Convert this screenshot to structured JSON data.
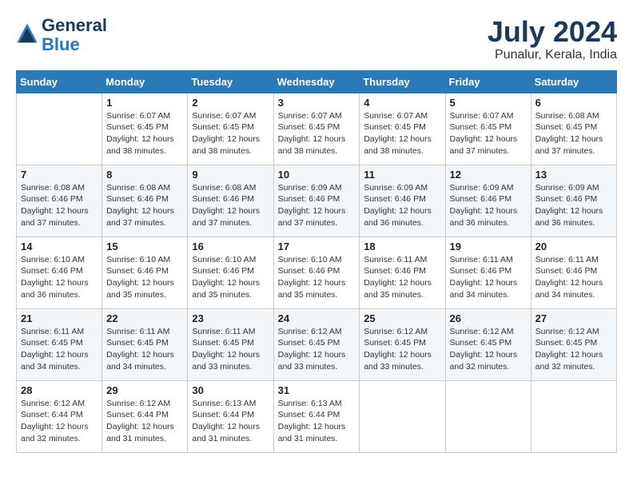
{
  "header": {
    "logo_line1": "General",
    "logo_line2": "Blue",
    "month_year": "July 2024",
    "location": "Punalur, Kerala, India"
  },
  "calendar": {
    "days_of_week": [
      "Sunday",
      "Monday",
      "Tuesday",
      "Wednesday",
      "Thursday",
      "Friday",
      "Saturday"
    ],
    "weeks": [
      [
        {
          "day": "",
          "info": ""
        },
        {
          "day": "1",
          "info": "Sunrise: 6:07 AM\nSunset: 6:45 PM\nDaylight: 12 hours\nand 38 minutes."
        },
        {
          "day": "2",
          "info": "Sunrise: 6:07 AM\nSunset: 6:45 PM\nDaylight: 12 hours\nand 38 minutes."
        },
        {
          "day": "3",
          "info": "Sunrise: 6:07 AM\nSunset: 6:45 PM\nDaylight: 12 hours\nand 38 minutes."
        },
        {
          "day": "4",
          "info": "Sunrise: 6:07 AM\nSunset: 6:45 PM\nDaylight: 12 hours\nand 38 minutes."
        },
        {
          "day": "5",
          "info": "Sunrise: 6:07 AM\nSunset: 6:45 PM\nDaylight: 12 hours\nand 37 minutes."
        },
        {
          "day": "6",
          "info": "Sunrise: 6:08 AM\nSunset: 6:45 PM\nDaylight: 12 hours\nand 37 minutes."
        }
      ],
      [
        {
          "day": "7",
          "info": "Sunrise: 6:08 AM\nSunset: 6:46 PM\nDaylight: 12 hours\nand 37 minutes."
        },
        {
          "day": "8",
          "info": "Sunrise: 6:08 AM\nSunset: 6:46 PM\nDaylight: 12 hours\nand 37 minutes."
        },
        {
          "day": "9",
          "info": "Sunrise: 6:08 AM\nSunset: 6:46 PM\nDaylight: 12 hours\nand 37 minutes."
        },
        {
          "day": "10",
          "info": "Sunrise: 6:09 AM\nSunset: 6:46 PM\nDaylight: 12 hours\nand 37 minutes."
        },
        {
          "day": "11",
          "info": "Sunrise: 6:09 AM\nSunset: 6:46 PM\nDaylight: 12 hours\nand 36 minutes."
        },
        {
          "day": "12",
          "info": "Sunrise: 6:09 AM\nSunset: 6:46 PM\nDaylight: 12 hours\nand 36 minutes."
        },
        {
          "day": "13",
          "info": "Sunrise: 6:09 AM\nSunset: 6:46 PM\nDaylight: 12 hours\nand 36 minutes."
        }
      ],
      [
        {
          "day": "14",
          "info": "Sunrise: 6:10 AM\nSunset: 6:46 PM\nDaylight: 12 hours\nand 36 minutes."
        },
        {
          "day": "15",
          "info": "Sunrise: 6:10 AM\nSunset: 6:46 PM\nDaylight: 12 hours\nand 35 minutes."
        },
        {
          "day": "16",
          "info": "Sunrise: 6:10 AM\nSunset: 6:46 PM\nDaylight: 12 hours\nand 35 minutes."
        },
        {
          "day": "17",
          "info": "Sunrise: 6:10 AM\nSunset: 6:46 PM\nDaylight: 12 hours\nand 35 minutes."
        },
        {
          "day": "18",
          "info": "Sunrise: 6:11 AM\nSunset: 6:46 PM\nDaylight: 12 hours\nand 35 minutes."
        },
        {
          "day": "19",
          "info": "Sunrise: 6:11 AM\nSunset: 6:46 PM\nDaylight: 12 hours\nand 34 minutes."
        },
        {
          "day": "20",
          "info": "Sunrise: 6:11 AM\nSunset: 6:46 PM\nDaylight: 12 hours\nand 34 minutes."
        }
      ],
      [
        {
          "day": "21",
          "info": "Sunrise: 6:11 AM\nSunset: 6:45 PM\nDaylight: 12 hours\nand 34 minutes."
        },
        {
          "day": "22",
          "info": "Sunrise: 6:11 AM\nSunset: 6:45 PM\nDaylight: 12 hours\nand 34 minutes."
        },
        {
          "day": "23",
          "info": "Sunrise: 6:11 AM\nSunset: 6:45 PM\nDaylight: 12 hours\nand 33 minutes."
        },
        {
          "day": "24",
          "info": "Sunrise: 6:12 AM\nSunset: 6:45 PM\nDaylight: 12 hours\nand 33 minutes."
        },
        {
          "day": "25",
          "info": "Sunrise: 6:12 AM\nSunset: 6:45 PM\nDaylight: 12 hours\nand 33 minutes."
        },
        {
          "day": "26",
          "info": "Sunrise: 6:12 AM\nSunset: 6:45 PM\nDaylight: 12 hours\nand 32 minutes."
        },
        {
          "day": "27",
          "info": "Sunrise: 6:12 AM\nSunset: 6:45 PM\nDaylight: 12 hours\nand 32 minutes."
        }
      ],
      [
        {
          "day": "28",
          "info": "Sunrise: 6:12 AM\nSunset: 6:44 PM\nDaylight: 12 hours\nand 32 minutes."
        },
        {
          "day": "29",
          "info": "Sunrise: 6:12 AM\nSunset: 6:44 PM\nDaylight: 12 hours\nand 31 minutes."
        },
        {
          "day": "30",
          "info": "Sunrise: 6:13 AM\nSunset: 6:44 PM\nDaylight: 12 hours\nand 31 minutes."
        },
        {
          "day": "31",
          "info": "Sunrise: 6:13 AM\nSunset: 6:44 PM\nDaylight: 12 hours\nand 31 minutes."
        },
        {
          "day": "",
          "info": ""
        },
        {
          "day": "",
          "info": ""
        },
        {
          "day": "",
          "info": ""
        }
      ]
    ]
  }
}
